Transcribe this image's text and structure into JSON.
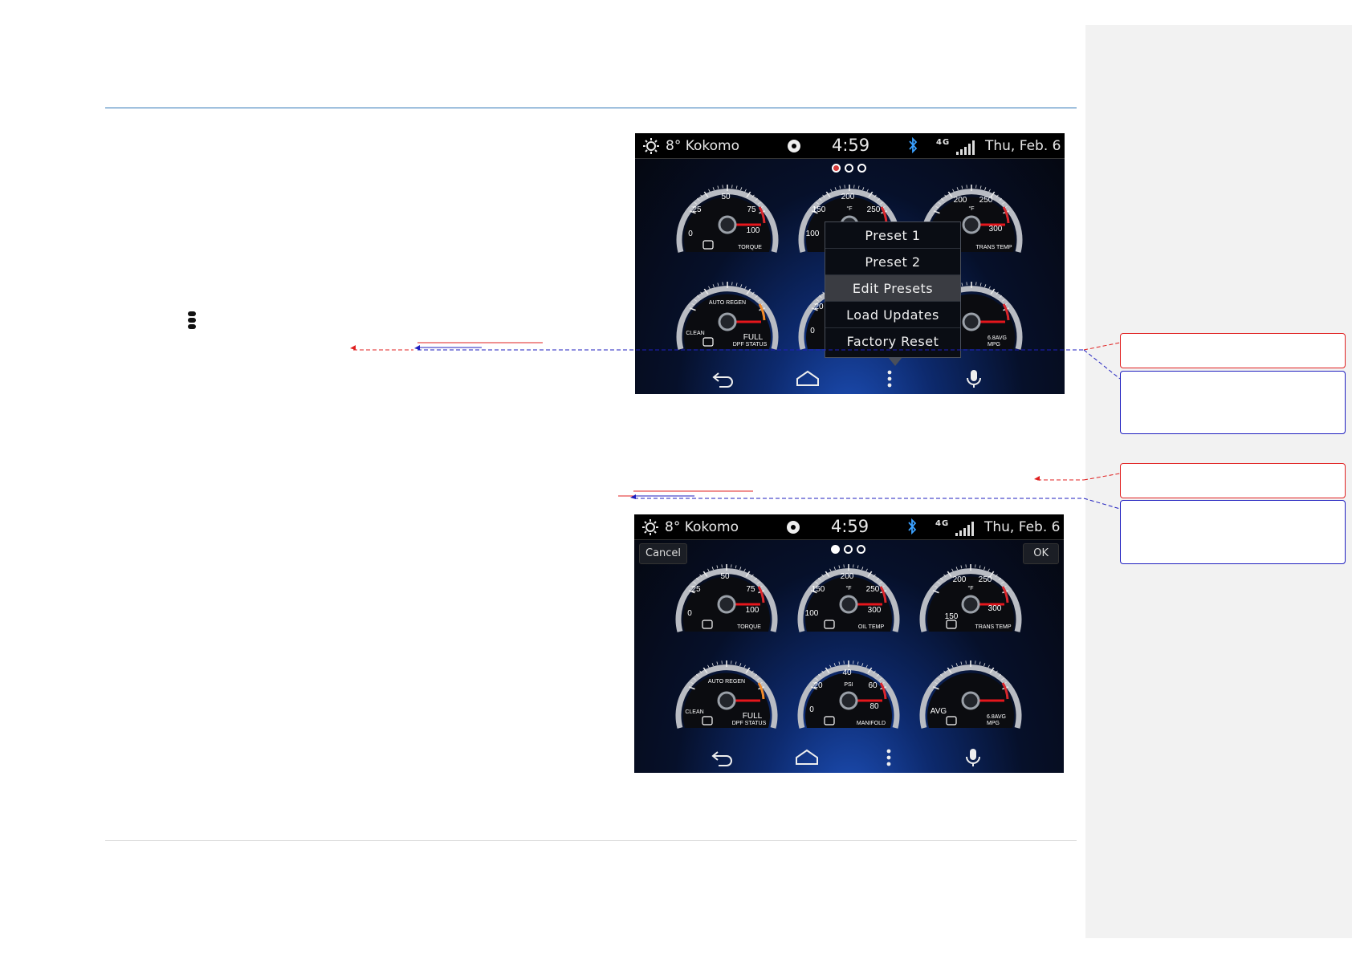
{
  "page": {
    "accent_color": "#2e75b6",
    "comment_red": "#e02020",
    "comment_blue": "#1f1fbf"
  },
  "doc": {
    "menu_icon": "vertical-ellipsis-icon"
  },
  "screen1": {
    "status": {
      "weather_icon": "sun-icon",
      "location": "8° Kokomo",
      "time": "4:59",
      "network": "4G",
      "date": "Thu, Feb. 6"
    },
    "popup": {
      "items": [
        {
          "label": "Preset 1",
          "selected": false
        },
        {
          "label": "Preset 2",
          "selected": false
        },
        {
          "label": "Edit Presets",
          "selected": true
        },
        {
          "label": "Load Updates",
          "selected": false
        },
        {
          "label": "Factory Reset",
          "selected": false
        }
      ]
    },
    "page_dot_active_color": "#d43a3a"
  },
  "screen2": {
    "status": {
      "weather_icon": "sun-icon",
      "location": "8° Kokomo",
      "time": "4:59",
      "network": "4G",
      "date": "Thu, Feb. 6"
    },
    "cancel_label": "Cancel",
    "ok_label": "OK"
  },
  "gauges": {
    "torque": {
      "ticks": [
        "0",
        "25",
        "50",
        "75",
        "100"
      ],
      "label": "TORQUE",
      "icon": "engine-percent-icon"
    },
    "oil_temp": {
      "ticks": [
        "100",
        "150",
        "200",
        "250",
        "300"
      ],
      "unit": "°F",
      "label": "OIL TEMP",
      "icon": "oil-can-icon"
    },
    "trans_temp": {
      "ticks": [
        "150",
        "200",
        "250",
        "300"
      ],
      "unit": "°F",
      "label": "TRANS TEMP",
      "icon": "transmission-gear-icon"
    },
    "dpf_status": {
      "ticks": [
        "CLEAN",
        "FULL"
      ],
      "center": "AUTO REGEN",
      "label": "DPF STATUS",
      "icon": "dpf-filter-icon"
    },
    "manifold": {
      "ticks": [
        "0",
        "20",
        "40",
        "60",
        "80"
      ],
      "unit": "PSI",
      "label": "MANIFOLD",
      "icon": "turbo-icon"
    },
    "mpg": {
      "ticks": [
        "AVG",
        "6.8AVG"
      ],
      "label": "MPG",
      "icon": "fuel-pump-icon"
    }
  },
  "navbar": [
    "back-arrow-icon",
    "home-icon",
    "menu-dots-icon",
    "microphone-icon"
  ]
}
